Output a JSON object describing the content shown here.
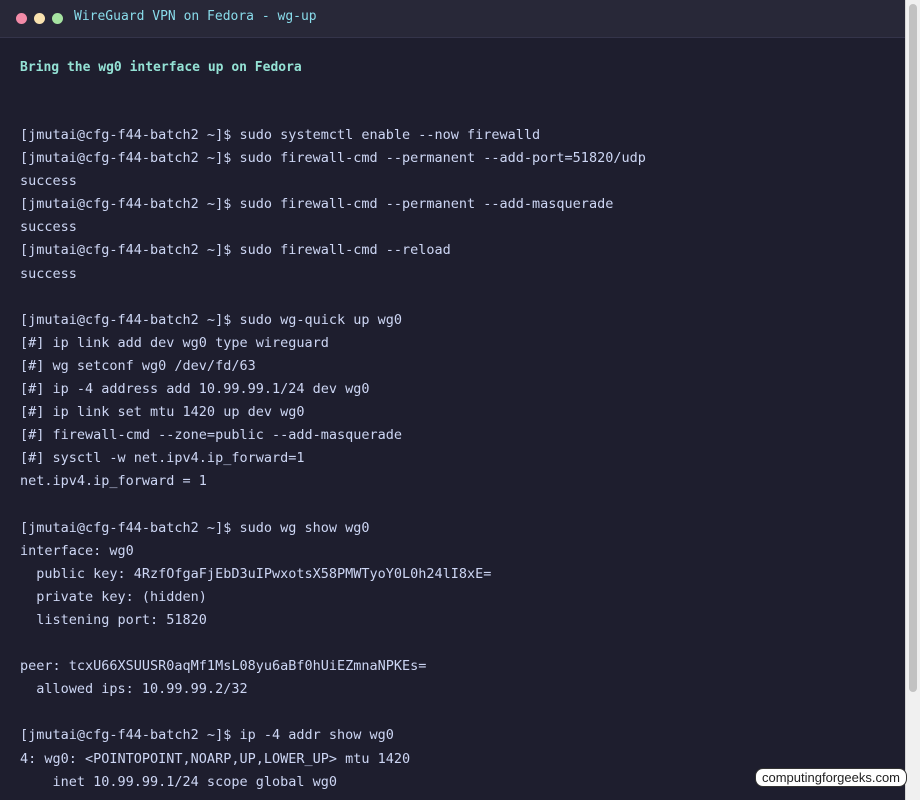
{
  "window": {
    "title": "WireGuard VPN on Fedora - wg-up"
  },
  "heading": "Bring the wg0 interface up on Fedora",
  "terminal_lines": [
    "[jmutai@cfg-f44-batch2 ~]$ sudo systemctl enable --now firewalld",
    "[jmutai@cfg-f44-batch2 ~]$ sudo firewall-cmd --permanent --add-port=51820/udp",
    "success",
    "[jmutai@cfg-f44-batch2 ~]$ sudo firewall-cmd --permanent --add-masquerade",
    "success",
    "[jmutai@cfg-f44-batch2 ~]$ sudo firewall-cmd --reload",
    "success",
    "",
    "[jmutai@cfg-f44-batch2 ~]$ sudo wg-quick up wg0",
    "[#] ip link add dev wg0 type wireguard",
    "[#] wg setconf wg0 /dev/fd/63",
    "[#] ip -4 address add 10.99.99.1/24 dev wg0",
    "[#] ip link set mtu 1420 up dev wg0",
    "[#] firewall-cmd --zone=public --add-masquerade",
    "[#] sysctl -w net.ipv4.ip_forward=1",
    "net.ipv4.ip_forward = 1",
    "",
    "[jmutai@cfg-f44-batch2 ~]$ sudo wg show wg0",
    "interface: wg0",
    "  public key: 4RzfOfgaFjEbD3uIPwxotsX58PMWTyoY0L0h24lI8xE=",
    "  private key: (hidden)",
    "  listening port: 51820",
    "",
    "peer: tcxU66XSUUSR0aqMf1MsL08yu6aBf0hUiEZmnaNPKEs=",
    "  allowed ips: 10.99.99.2/32",
    "",
    "[jmutai@cfg-f44-batch2 ~]$ ip -4 addr show wg0",
    "4: wg0: <POINTOPOINT,NOARP,UP,LOWER_UP> mtu 1420",
    "    inet 10.99.99.1/24 scope global wg0"
  ],
  "watermark": "computingforgeeks.com",
  "colors": {
    "background": "#1e1e2e",
    "titlebar": "#282838",
    "title_text": "#89dceb",
    "heading_text": "#94e2d5",
    "terminal_text": "#cdd6f4",
    "dot_close": "#f38ba8",
    "dot_minimize": "#f9e2af",
    "dot_maximize": "#a6e3a1"
  }
}
